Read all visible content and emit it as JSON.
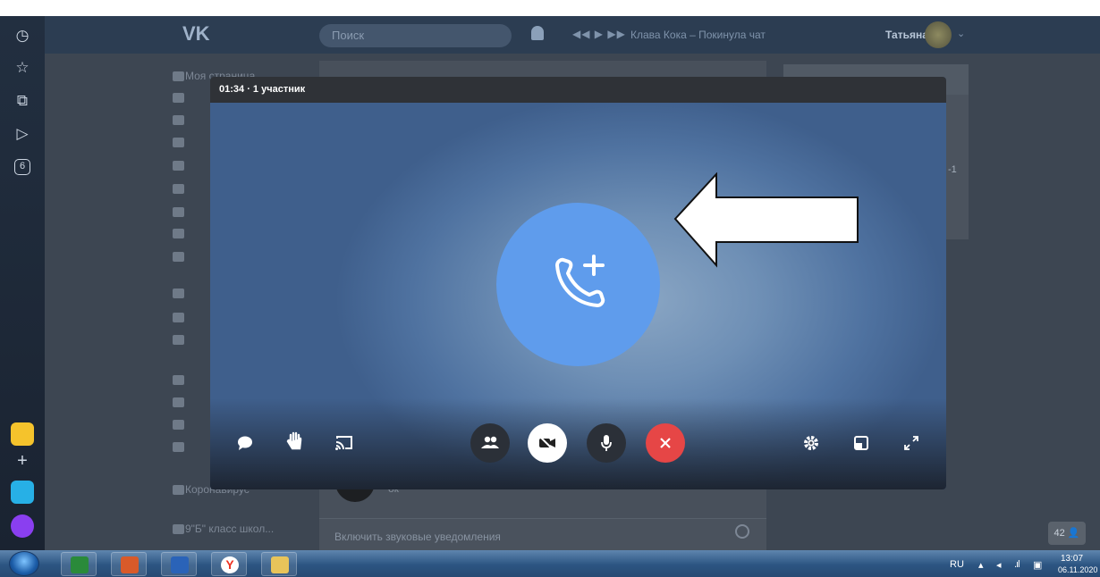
{
  "browser_sidebar": {
    "buttons": [
      "clock-icon",
      "star-icon",
      "tabs-icon",
      "play-icon",
      "6"
    ]
  },
  "vk_header": {
    "logo": "VK",
    "search_placeholder": "Поиск",
    "now_playing": "Клава Кока – Покинула чат",
    "user_name": "Татьяна"
  },
  "left_menu": {
    "first_item": "Моя страница",
    "group_item": "Коронавирус",
    "bottom_item": "9\"Б\" класс школ..."
  },
  "chat": {
    "last_message": "ок",
    "sound_notifications": "Включить звуковые уведомления"
  },
  "online_badge": "42",
  "call": {
    "status": "01:34 · 1 участник",
    "accent_color": "#5f9cec",
    "end_color": "#e64646"
  },
  "taskbar": {
    "language": "RU",
    "time": "13:07",
    "date": "06.11.2020"
  }
}
